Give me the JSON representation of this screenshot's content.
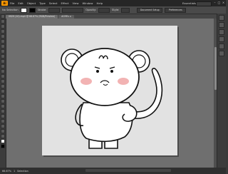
{
  "app": {
    "logo_text": "Ai",
    "menus": [
      "File",
      "Edit",
      "Object",
      "Type",
      "Select",
      "Effect",
      "View",
      "Window",
      "Help"
    ],
    "workspace": "Essentials",
    "colors": {
      "accent": "#ff9a00"
    }
  },
  "control_bar": {
    "selection_label": "No Selection",
    "stroke_label": "Stroke:",
    "stroke_value": "1 pt",
    "opacity_label": "Opacity:",
    "opacity_value": "100%",
    "style_label": "Style:",
    "doc_setup": "Document Setup",
    "preferences": "Preferences"
  },
  "document_tabs": [
    {
      "label": "0929 (10).mp4 @ 66.67% (RGB/Preview)",
      "active": true
    },
    {
      "label": "ACMEs x",
      "active": false
    }
  ],
  "status": {
    "zoom": "66.67%",
    "page": "1",
    "info": "Selection"
  },
  "icons": [
    "close-icon",
    "minimize-icon",
    "maximize-icon",
    "selection-tool-icon",
    "direct-selection-icon",
    "pen-tool-icon",
    "type-tool-icon",
    "brush-tool-icon",
    "rectangle-tool-icon",
    "zoom-tool-icon",
    "hand-tool-icon"
  ]
}
